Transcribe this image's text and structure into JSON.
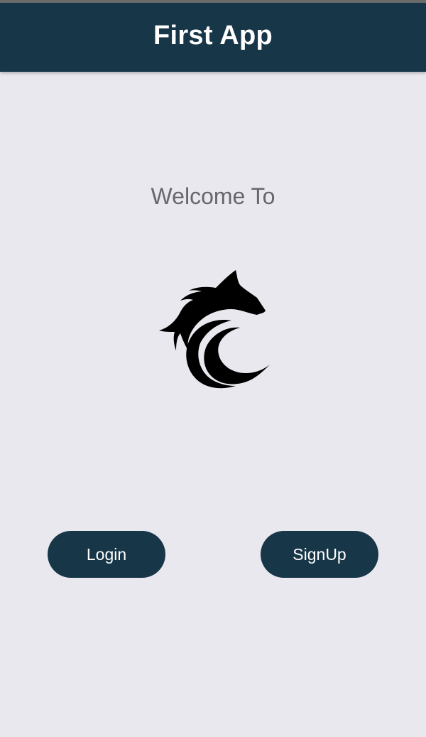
{
  "app_bar": {
    "title": "First App",
    "background_color": "#173648"
  },
  "main": {
    "welcome_text": "Welcome To",
    "logo_icon": "wolf-logo-icon"
  },
  "buttons": {
    "login_label": "Login",
    "signup_label": "SignUp",
    "background_color": "#173648"
  }
}
